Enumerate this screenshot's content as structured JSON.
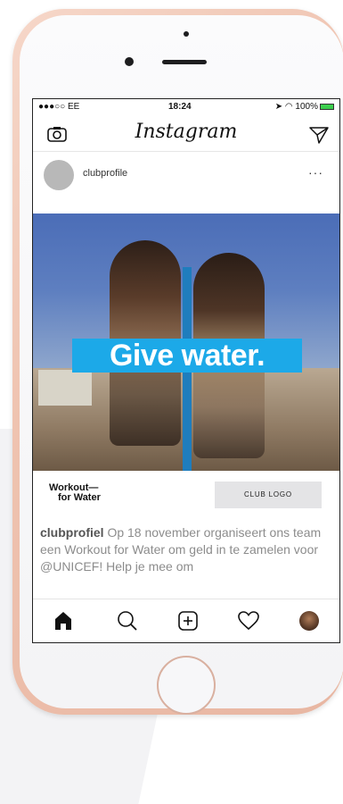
{
  "status_bar": {
    "carrier": "●●●○○ EE",
    "time": "18:24",
    "battery": "100%"
  },
  "nav": {
    "app_title": "Instagram",
    "camera_icon": "camera-icon",
    "send_icon": "send-icon"
  },
  "post": {
    "username": "clubprofile",
    "more": "···",
    "banner_text": "Give water.",
    "workout_logo_line1": "Workout—",
    "workout_logo_line2": "for Water",
    "club_logo": "CLUB LOGO",
    "caption_user": "clubprofiel",
    "caption_text": " Op 18 november organiseert ons team een Workout for Water om geld in te zamelen voor @UNICEF! Help je mee om"
  },
  "tabbar": {
    "icons": [
      "home-icon",
      "search-icon",
      "add-icon",
      "heart-icon",
      "profile-icon"
    ]
  },
  "colors": {
    "banner": "#1ca9e8",
    "battery": "#3ccf4e",
    "phone_shell": "#efc3b0"
  }
}
